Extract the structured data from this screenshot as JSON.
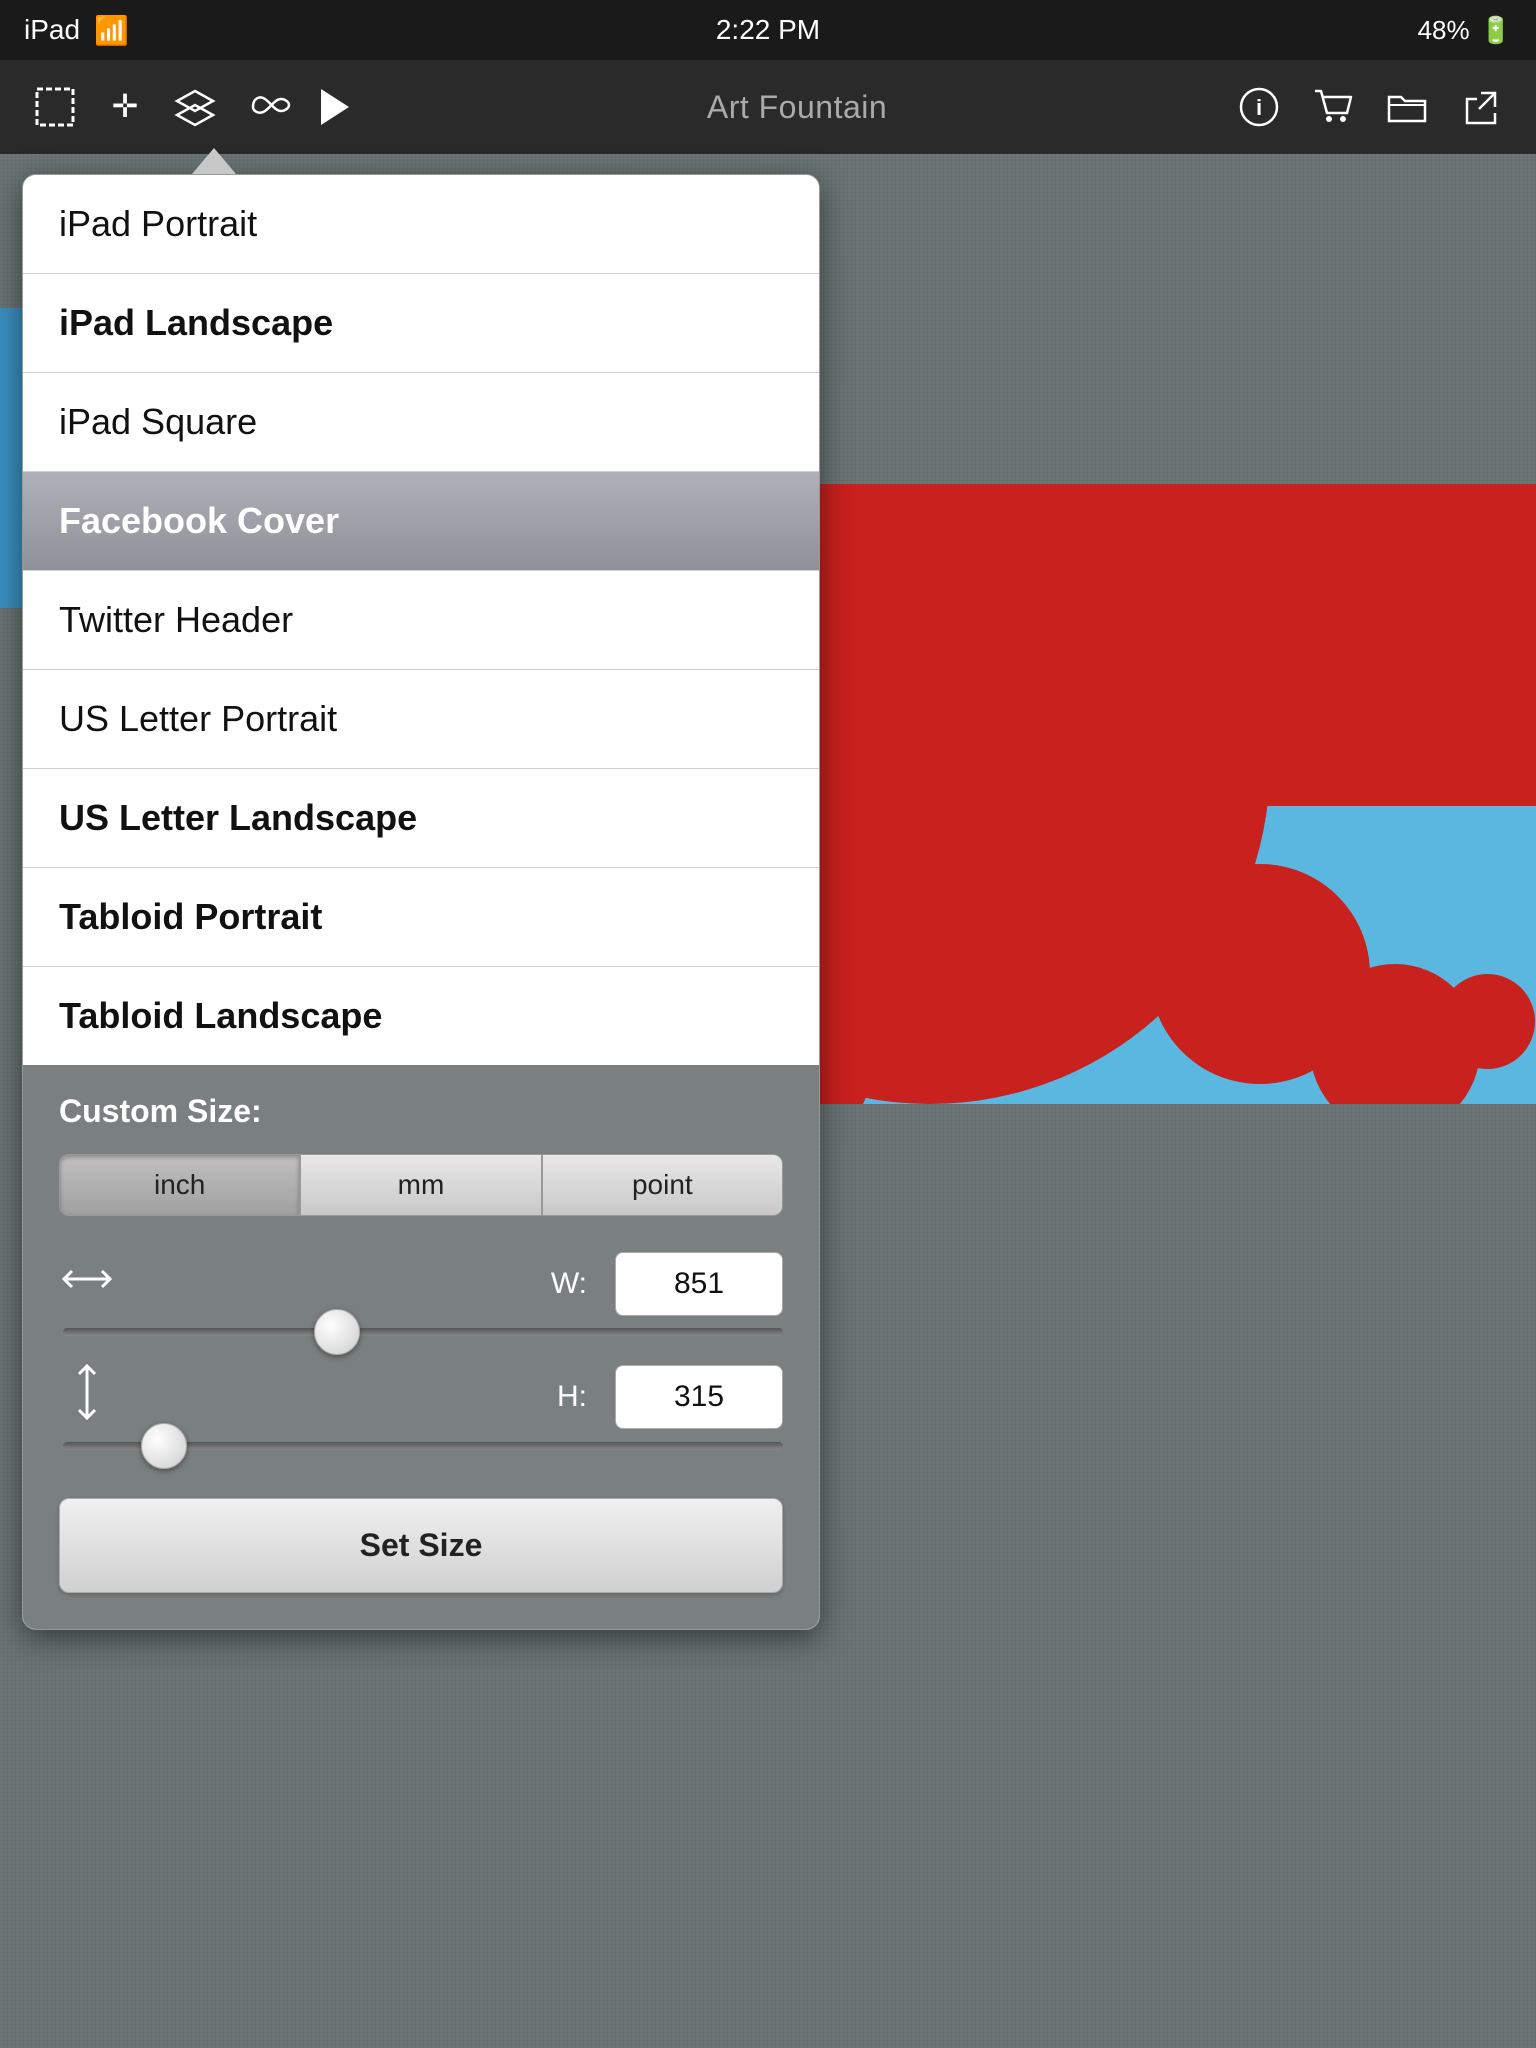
{
  "statusBar": {
    "device": "iPad",
    "wifi": "wifi",
    "time": "2:22 PM",
    "battery": "48%"
  },
  "toolbar": {
    "title": "Art Fountain",
    "icons": {
      "select": "⊞",
      "move": "✛",
      "layers": "≡",
      "infinity": "∞",
      "play": "▶",
      "info": "ⓘ",
      "cart": "🛒",
      "folder": "📁",
      "share": "↗"
    }
  },
  "dropdown": {
    "items": [
      {
        "label": "iPad Portrait",
        "selected": false
      },
      {
        "label": "iPad Landscape",
        "selected": false
      },
      {
        "label": "iPad Square",
        "selected": false
      },
      {
        "label": "Facebook Cover",
        "selected": true
      },
      {
        "label": "Twitter Header",
        "selected": false
      },
      {
        "label": "US Letter Portrait",
        "selected": false
      },
      {
        "label": "US Letter Landscape",
        "selected": false
      },
      {
        "label": "Tabloid Portrait",
        "selected": false
      },
      {
        "label": "Tabloid Landscape",
        "selected": false
      }
    ]
  },
  "customSize": {
    "title": "Custom Size:",
    "units": [
      {
        "label": "inch",
        "active": true
      },
      {
        "label": "mm",
        "active": false
      },
      {
        "label": "point",
        "active": false
      }
    ],
    "width": {
      "label": "W:",
      "value": "851",
      "sliderPosition": "38"
    },
    "height": {
      "label": "H:",
      "value": "315",
      "sliderPosition": "14"
    },
    "setButtonLabel": "Set Size"
  }
}
